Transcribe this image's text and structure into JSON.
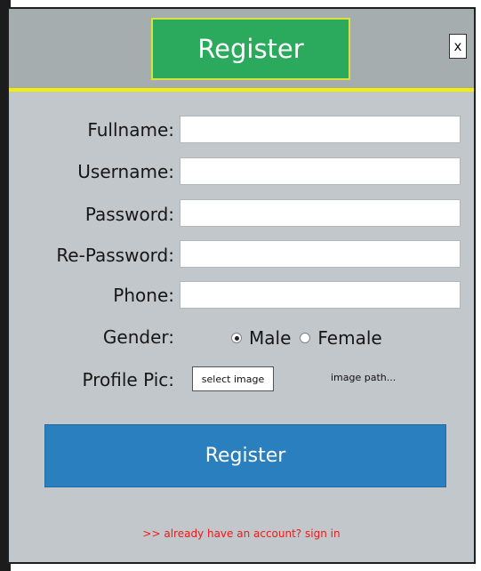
{
  "window": {
    "title": "Register",
    "close_label": "x"
  },
  "form": {
    "fullname": {
      "label": "Fullname:",
      "value": ""
    },
    "username": {
      "label": "Username:",
      "value": ""
    },
    "password": {
      "label": "Password:",
      "value": ""
    },
    "repassword": {
      "label": "Re-Password:",
      "value": ""
    },
    "phone": {
      "label": "Phone:",
      "value": ""
    },
    "gender": {
      "label": "Gender:",
      "options": [
        {
          "label": "Male",
          "selected": true
        },
        {
          "label": "Female",
          "selected": false
        }
      ]
    },
    "profile_pic": {
      "label": "Profile Pic:",
      "button_label": "select image",
      "path_text": "image path..."
    }
  },
  "actions": {
    "register_label": "Register",
    "signin_text": ">> already have an account? sign in"
  },
  "colors": {
    "title_bg": "#2baa5d",
    "accent_border": "#f2ee08",
    "register_button": "#2a7fbf",
    "link": "#ee1a1a",
    "panel_bg": "#c2c7cb"
  }
}
